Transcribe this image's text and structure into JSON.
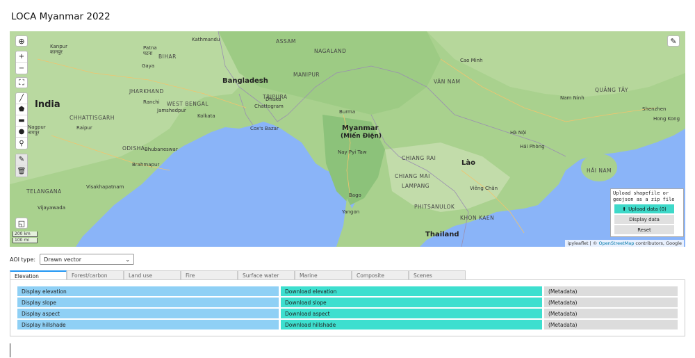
{
  "app": {
    "title": "LOCA Myanmar 2022"
  },
  "map": {
    "countries": [
      "India",
      "Bangladesh",
      "Myanmar",
      "(Miến Điện)",
      "Thailand",
      "Lào"
    ],
    "places": [
      "Kanpur",
      "कानपुर",
      "Patna",
      "पटना",
      "BIHAR",
      "ASSAM",
      "NAGALAND",
      "Gaya",
      "Kathmandu",
      "Cao Minh",
      "JHARKHAND",
      "Dhaka",
      "MANIPUR",
      "Ranchi",
      "Jamshedpur",
      "TRIPURA",
      "WEST BENGAL",
      "Kolkata",
      "Chattogram",
      "Burma",
      "CHHATTISGARH",
      "Raipur",
      "Nagpur",
      "नागपुर",
      "ODISHA",
      "Bhubaneswar",
      "Brahmapur",
      "Cox's Bazar",
      "Nay Pyi Taw",
      "CHIANG RAI",
      "Hà Nội",
      "Hải Phòng",
      "VÂN NAM",
      "Nam Ninh",
      "QUẢNG TÂY",
      "Shenzhen",
      "Hong Kong",
      "HẢI NAM",
      "Visakhapatnam",
      "TELANGANA",
      "Vijayawada",
      "Bago",
      "Yangon",
      "CHIANG MAI",
      "LAMPANG",
      "Viêng Chăn",
      "PHITSANULOK",
      "KHON KAEN"
    ],
    "zoom_in": "+",
    "zoom_out": "−",
    "scale": [
      "200 km",
      "100 mi"
    ],
    "attribution": {
      "lib": "ipyleaflet",
      "sep": " | © ",
      "osm": "OpenStreetMap",
      "rest": " contributors, Google"
    },
    "upload_panel": {
      "hint": "Upload shapefile or\ngeojson as a zip file",
      "upload_label": "Upload data (0)",
      "display_label": "Display data",
      "reset_label": "Reset"
    }
  },
  "aoi": {
    "label": "AOI type:",
    "value": "Drawn vector"
  },
  "tabs": [
    {
      "label": "Elevation",
      "active": true
    },
    {
      "label": "Forest/carbon"
    },
    {
      "label": "Land use"
    },
    {
      "label": "Fire"
    },
    {
      "label": "Surface water"
    },
    {
      "label": "Marine"
    },
    {
      "label": "Composite"
    },
    {
      "label": "Scenes"
    }
  ],
  "rows": [
    {
      "display": "Display elevation",
      "download": "Download elevation",
      "meta": "(Metadata)"
    },
    {
      "display": "Display slope",
      "download": "Download slope",
      "meta": "(Metadata)"
    },
    {
      "display": "Display aspect",
      "download": "Download aspect",
      "meta": "(Metadata)"
    },
    {
      "display": "Display hillshade",
      "download": "Download hillshade",
      "meta": "(Metadata)"
    }
  ],
  "colors": {
    "display": "#8fd0f5",
    "download": "#3ddfcf",
    "meta": "#dcdcdc",
    "tab_accent": "#2196f3",
    "upload": "#3ed9c9"
  }
}
